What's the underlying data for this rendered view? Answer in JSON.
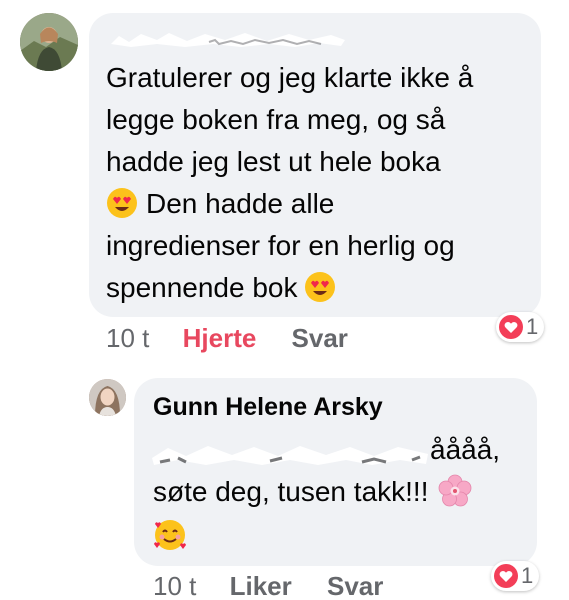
{
  "comments": [
    {
      "author": "",
      "lines": [
        "Gratulerer og jeg klarte ikke å",
        "legge boken fra meg, og så",
        "hadde jeg lest ut hele boka",
        "Den hadde alle",
        "ingredienser for en herlig og",
        "spennende bok"
      ],
      "time": "10 t",
      "reaction_label": "Hjerte",
      "reply_label": "Svar",
      "reaction_count": "1",
      "reaction_icon": "heart-icon",
      "emoji": "heart-eyes-emoji"
    },
    {
      "author": "Gunn Helene Arsky",
      "line1_visible": "åååå,",
      "line2": "søte deg, tusen takk!!!",
      "time": "10 t",
      "reaction_label": "Liker",
      "reply_label": "Svar",
      "reaction_count": "1",
      "reaction_icon": "heart-icon",
      "emoji": [
        "cherry-blossom-emoji",
        "smiling-hearts-emoji"
      ]
    }
  ],
  "colors": {
    "bubble": "#f0f2f5",
    "text": "#050505",
    "meta": "#65676b",
    "love": "#e8485f",
    "heart_badge": "#f33e58"
  }
}
